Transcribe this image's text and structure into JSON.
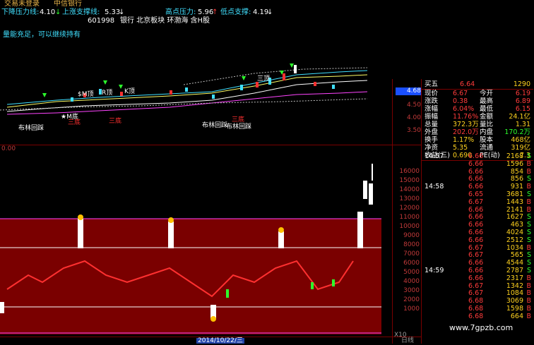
{
  "menu": {
    "items": [
      "交易未登录",
      "中信银行"
    ]
  },
  "indicators": {
    "down_pressure_label": "下降压力线:",
    "down_pressure_value": "4.10",
    "up_support_label": "上涨支撑线:",
    "up_support_value": "5.33",
    "high_pressure_label": "高点压力:",
    "high_pressure_value": "5.96",
    "low_support_label": "低点支撑:",
    "low_support_value": "4.19"
  },
  "stock": {
    "code": "601998",
    "tags": "银行 北京板块 环渤海 含H股"
  },
  "notice": "量能充足，可以继续持有",
  "chart_labels": {
    "m_bottom": "★M底",
    "three_bottom_1": "三底",
    "three_bottom_2": "三底",
    "three_bottom_3": "三底",
    "boll_1": "布林回踩",
    "boll_2": "布林回踩",
    "boll_3": "布林回踩",
    "r_top": "R顶",
    "k_top": "K顶",
    "m_top": "$M顶",
    "san_top": "三顶",
    "price_axis": [
      "4.50",
      "4.00",
      "3.50"
    ],
    "price_marker": "4.68",
    "lower_start": "0.00",
    "lower_axis": [
      "16000",
      "15000",
      "14000",
      "13000",
      "12000",
      "11000",
      "10000",
      "9000",
      "8000",
      "7000",
      "6000",
      "5000",
      "4000",
      "3000",
      "2000",
      "1000"
    ],
    "x10": "X10",
    "date": "2014/10/22/三",
    "axis_right": "日线"
  },
  "quote": {
    "buy5_label": "买五",
    "buy5_price": "6.64",
    "buy5_vol": "1290",
    "rows": [
      {
        "l1": "现价",
        "v1": "6.67",
        "l2": "今开",
        "v2": "6.19"
      },
      {
        "l1": "涨跌",
        "v1": "0.38",
        "l2": "最高",
        "v2": "6.89"
      },
      {
        "l1": "涨幅",
        "v1": "6.04%",
        "l2": "最低",
        "v2": "6.15"
      },
      {
        "l1": "振幅",
        "v1": "11.76%",
        "l2": "金额",
        "v2": "24.1亿"
      },
      {
        "l1": "总量",
        "v1": "372.3万",
        "l2": "量比",
        "v2": "1.31"
      },
      {
        "l1": "外盘",
        "v1": "202.0万",
        "l2": "内盘",
        "v2": "170.2万"
      },
      {
        "l1": "换手",
        "v1": "1.17%",
        "l2": "股本",
        "v2": "468亿"
      },
      {
        "l1": "净资",
        "v1": "5.35",
        "l2": "流通",
        "v2": "319亿"
      },
      {
        "l1": "收益(三)",
        "v1": "0.690",
        "l2": "PE(动)",
        "v2": "7.3"
      }
    ]
  },
  "ticks": [
    {
      "t": "14:57",
      "p": "6.66",
      "v": "2168",
      "s": "S"
    },
    {
      "t": "",
      "p": "6.66",
      "v": "1596",
      "s": "B"
    },
    {
      "t": "",
      "p": "6.66",
      "v": "854",
      "s": "B"
    },
    {
      "t": "",
      "p": "6.66",
      "v": "856",
      "s": "S"
    },
    {
      "t": "14:58",
      "p": "6.66",
      "v": "931",
      "s": "B"
    },
    {
      "t": "",
      "p": "6.65",
      "v": "3681",
      "s": "S"
    },
    {
      "t": "",
      "p": "6.67",
      "v": "1443",
      "s": "B"
    },
    {
      "t": "",
      "p": "6.66",
      "v": "2141",
      "s": "B"
    },
    {
      "t": "",
      "p": "6.66",
      "v": "1627",
      "s": "S"
    },
    {
      "t": "",
      "p": "6.66",
      "v": "463",
      "s": "S"
    },
    {
      "t": "",
      "p": "6.66",
      "v": "4024",
      "s": "S"
    },
    {
      "t": "",
      "p": "6.66",
      "v": "2512",
      "s": "S"
    },
    {
      "t": "",
      "p": "6.67",
      "v": "1034",
      "s": "B"
    },
    {
      "t": "",
      "p": "6.67",
      "v": "565",
      "s": "S"
    },
    {
      "t": "",
      "p": "6.66",
      "v": "4544",
      "s": "S"
    },
    {
      "t": "14:59",
      "p": "6.66",
      "v": "2787",
      "s": "S"
    },
    {
      "t": "",
      "p": "6.66",
      "v": "2317",
      "s": "B"
    },
    {
      "t": "",
      "p": "6.67",
      "v": "1342",
      "s": "B"
    },
    {
      "t": "",
      "p": "6.67",
      "v": "1084",
      "s": "B"
    },
    {
      "t": "",
      "p": "6.68",
      "v": "3069",
      "s": "B"
    },
    {
      "t": "",
      "p": "6.68",
      "v": "1598",
      "s": "B"
    },
    {
      "t": "",
      "p": "6.68",
      "v": "664",
      "s": "B"
    }
  ],
  "watermark": "www.7gpzb.com",
  "colors": {
    "up": "#ff3030",
    "down": "#2cff2c",
    "panel_bg": "#7a0000",
    "accent": "#ffd21f"
  }
}
